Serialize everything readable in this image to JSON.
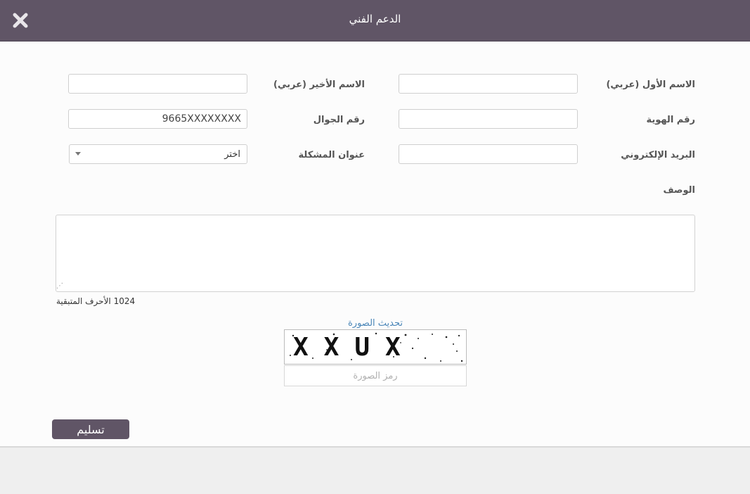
{
  "dialog": {
    "title": "الدعم الفني",
    "close_icon": "close-x-icon"
  },
  "form": {
    "first_name_label": "الاسم الأول (عربي)",
    "first_name_value": "",
    "last_name_label": "الاسم الأخير (عربي)",
    "last_name_value": "",
    "id_number_label": "رقم الهوية",
    "id_number_value": "",
    "mobile_label": "رقم الجوال",
    "mobile_value": "9665XXXXXXXX",
    "email_label": "البريد الإلكتروني",
    "email_value": "",
    "issue_title_label": "عنوان المشكلة",
    "issue_title_selected": "اختر",
    "description_label": "الوصف",
    "description_value": "",
    "chars_remaining": "1024 الأحرف المتبقية"
  },
  "captcha": {
    "refresh_label": "تحديث الصورة",
    "image_text": "XXUX",
    "input_placeholder": "رمز الصورة"
  },
  "actions": {
    "submit_label": "تسليم"
  },
  "colors": {
    "header": "#605566",
    "button": "#605566",
    "link": "#4a86b8"
  }
}
